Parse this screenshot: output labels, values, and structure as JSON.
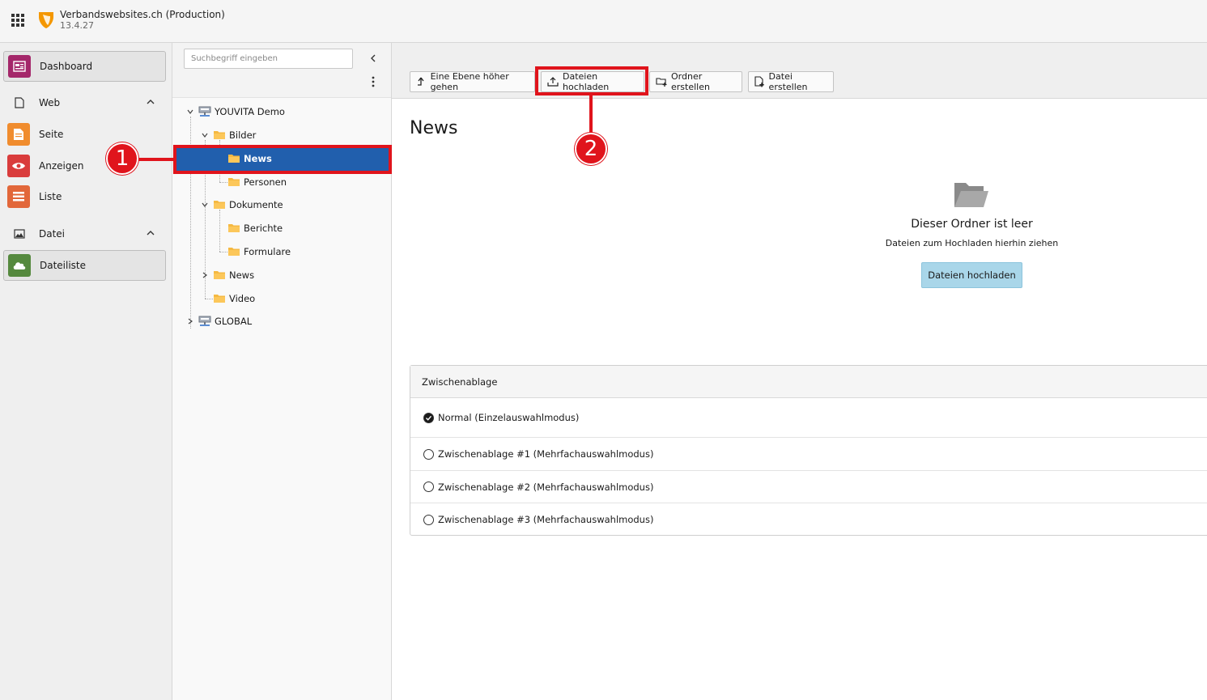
{
  "topbar": {
    "site_title": "Verbandswebsites.ch (Production)",
    "version": "13.4.27"
  },
  "modules": {
    "dashboard": "Dashboard",
    "web_group": "Web",
    "seite": "Seite",
    "anzeigen": "Anzeigen",
    "liste": "Liste",
    "datei_group": "Datei",
    "dateiliste": "Dateiliste",
    "colors": {
      "dashboard": "#a4276a",
      "seite": "#f08c2e",
      "anzeigen": "#d93c3c",
      "liste": "#e2673a",
      "dateiliste": "#55893e"
    }
  },
  "tree": {
    "search_placeholder": "Suchbegriff eingeben",
    "nodes": {
      "root": "YOUVITA Demo",
      "bilder": "Bilder",
      "bilder_news": "News",
      "personen": "Personen",
      "dokumente": "Dokumente",
      "berichte": "Berichte",
      "formulare": "Formulare",
      "news": "News",
      "video": "Video",
      "global": "GLOBAL"
    }
  },
  "toolbar": {
    "up_level": "Eine Ebene höher gehen",
    "upload": "Dateien hochladen",
    "create_folder": "Ordner erstellen",
    "create_file": "Datei erstellen"
  },
  "main": {
    "title": "News",
    "empty_title": "Dieser Ordner ist leer",
    "empty_sub": "Dateien zum Hochladen hierhin ziehen",
    "upload_button": "Dateien hochladen"
  },
  "clipboard": {
    "header": "Zwischenablage",
    "options": [
      {
        "label": "Normal (Einzelauswahlmodus)",
        "checked": true
      },
      {
        "label": "Zwischenablage #1 (Mehrfachauswahlmodus)",
        "checked": false
      },
      {
        "label": "Zwischenablage #2 (Mehrfachauswahlmodus)",
        "checked": false
      },
      {
        "label": "Zwischenablage #3 (Mehrfachauswahlmodus)",
        "checked": false
      }
    ]
  },
  "annotations": {
    "badge_1": "1",
    "badge_2": "2",
    "color": "#e0141c"
  }
}
